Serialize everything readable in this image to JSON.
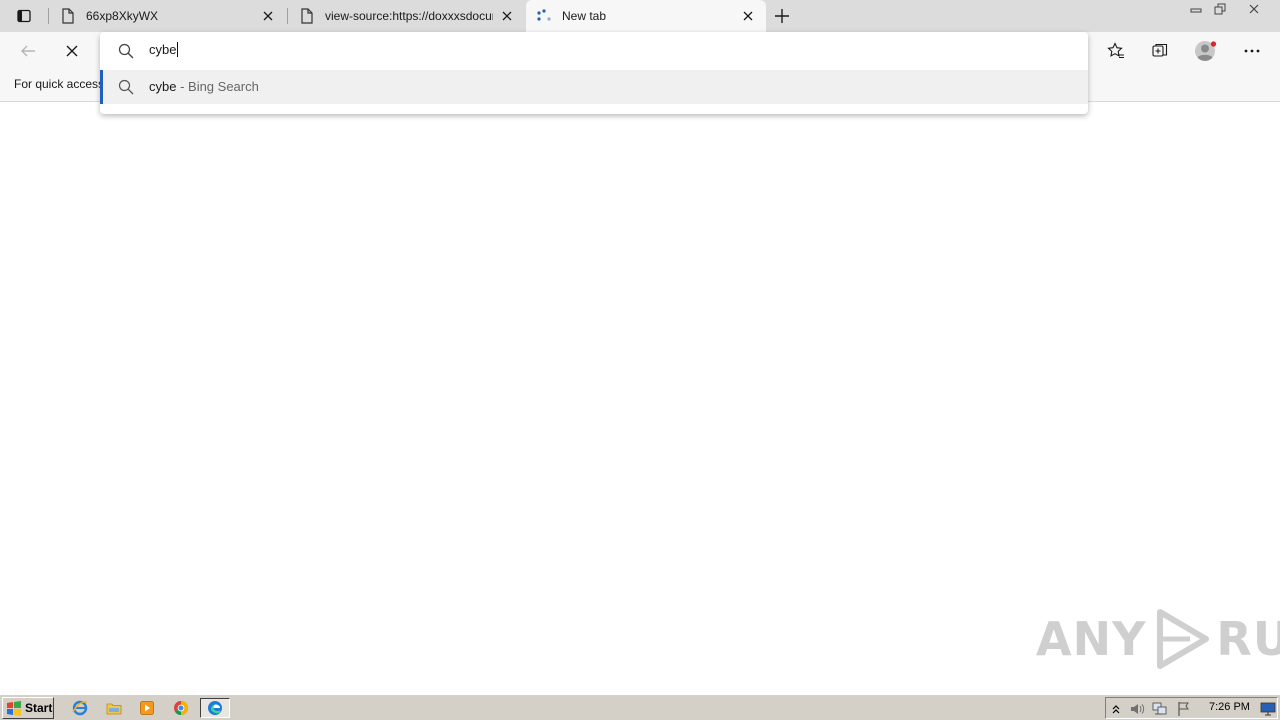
{
  "browser": {
    "tabs": [
      {
        "title": "66xp8XkyWX",
        "active": false
      },
      {
        "title": "view-source:https://doxxxsdocum",
        "active": false
      },
      {
        "title": "New tab",
        "active": true
      }
    ]
  },
  "omnibox": {
    "query": "cybe",
    "suggestion": {
      "query": "cybe",
      "suffix": " - Bing Search"
    }
  },
  "favorites_bar": {
    "text": "For quick access"
  },
  "watermark": {
    "left": "ANY",
    "right": "RUN"
  },
  "taskbar": {
    "start_label": "Start",
    "clock": "7:26 PM"
  },
  "colors": {
    "accent": "#1f5fbf",
    "tabstrip": "#dcdcdc",
    "taskbar": "#d4d0c8"
  }
}
